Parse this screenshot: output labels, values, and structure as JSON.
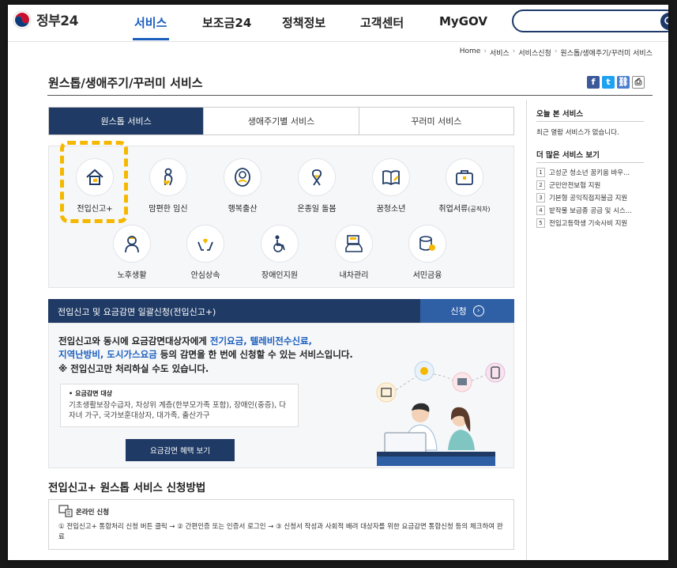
{
  "header": {
    "logo_text": "정부24",
    "nav": [
      "서비스",
      "보조금24",
      "정책정보",
      "고객센터",
      "MyGOV"
    ]
  },
  "breadcrumb": [
    "Home",
    "서비스",
    "서비스신청",
    "원스톱/생애주기/꾸러미 서비스"
  ],
  "page_title": "원스톱/생애주기/꾸러미 서비스",
  "share": [
    "f",
    "t",
    "link",
    "print"
  ],
  "tabs": [
    "원스톱 서비스",
    "생애주기별 서비스",
    "꾸러미 서비스"
  ],
  "services": [
    {
      "label": "전입신고+",
      "icon": "house-icon"
    },
    {
      "label": "맘편한 임신",
      "icon": "pregnant-icon"
    },
    {
      "label": "행복출산",
      "icon": "baby-icon"
    },
    {
      "label": "온종일 돌봄",
      "icon": "ribbon-icon"
    },
    {
      "label": "꿈청소년",
      "icon": "book-icon"
    },
    {
      "label": "취업서류",
      "label_small": "(공직자)",
      "icon": "briefcase-icon"
    },
    {
      "label": "노후생활",
      "icon": "elderly-icon"
    },
    {
      "label": "안심상속",
      "icon": "hands-icon"
    },
    {
      "label": "장애인지원",
      "icon": "wheelchair-icon"
    },
    {
      "label": "내차관리",
      "icon": "car-icon"
    },
    {
      "label": "서민금융",
      "icon": "coins-icon"
    }
  ],
  "banner": {
    "title": "전입신고 및 요금감면 일괄신청(전입신고+)",
    "apply_label": "신청"
  },
  "description": {
    "line1_a": "전입신고와 동시에 요금감면대상자에게 ",
    "line1_hl": "전기요금, 텔레비전수신료,",
    "line2_hl": "지역난방비, 도시가스요금 ",
    "line2_b": "등의 감면을 한 번에 신청할 수 있는 서비스",
    "line2_c": "입니다.",
    "note": "※ 전입신고만 처리하실 수도 있습니다."
  },
  "discount": {
    "heading": "요금감면 대상",
    "body": "기초생활보장수급자, 차상위 계층(한부모가족 포함), 장애인(중증), 다자녀 가구, 국가보훈대상자, 대가족, 출산가구"
  },
  "benefit_button": "요금감면 혜택 보기",
  "method": {
    "title": "전입신고+ 원스톱 서비스 신청방법",
    "online_title": "온라인 신청",
    "steps": "① 전입신고+ 통합처리 신청 버튼 클릭 → ② 간편인증 또는 인증서 로그인 → ③ 신청서 작성과 사회적 배려 대상자를 위한 요금감면 통합신청 등의 체크하여 완료"
  },
  "sidebar": {
    "recent_title": "오늘 본 서비스",
    "recent_empty": "최근 열람 서비스가 없습니다.",
    "more_title": "더 많은 서비스 보기",
    "more_items": [
      {
        "num": "1",
        "text": "고성군 청소년 꿈키움 바우..."
      },
      {
        "num": "2",
        "text": "군민안전보험 지원"
      },
      {
        "num": "3",
        "text": "기본형 공익직접지불금 지원"
      },
      {
        "num": "4",
        "text": "밭작물 보급종 공급 및 시스..."
      },
      {
        "num": "5",
        "text": "전입고등학생 기숙사비 지원"
      }
    ]
  },
  "colors": {
    "primary": "#1f3a64",
    "accent": "#1b5fbd",
    "highlight": "#f5b800"
  }
}
